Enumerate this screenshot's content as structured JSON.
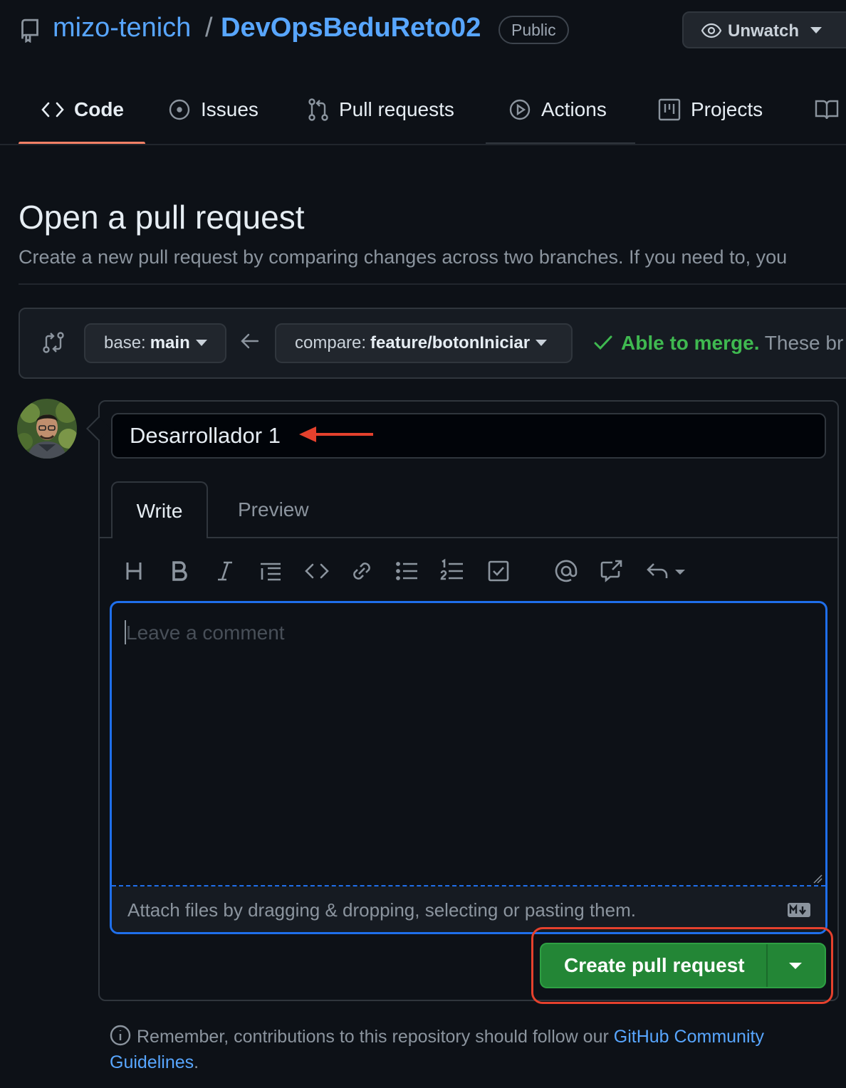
{
  "repo": {
    "owner": "mizo-tenich",
    "separator": "/",
    "name": "DevOpsBeduReto02",
    "visibility": "Public",
    "watch_label": "Unwatch"
  },
  "nav": {
    "tabs": [
      {
        "label": "Code",
        "icon": "code-icon",
        "selected": true
      },
      {
        "label": "Issues",
        "icon": "issue-icon"
      },
      {
        "label": "Pull requests",
        "icon": "pull-request-icon"
      },
      {
        "label": "Actions",
        "icon": "play-icon"
      },
      {
        "label": "Projects",
        "icon": "project-icon"
      },
      {
        "label": "",
        "icon": "book-icon"
      }
    ]
  },
  "page": {
    "title": "Open a pull request",
    "subtitle": "Create a new pull request by comparing changes across two branches. If you need to, you"
  },
  "compare": {
    "base_prefix": "base:",
    "base_branch": "main",
    "compare_prefix": "compare:",
    "compare_branch": "feature/botonIniciar",
    "merge_status": "Able to merge.",
    "merge_detail": "These br"
  },
  "form": {
    "title_value": "Desarrollador 1",
    "tab_write": "Write",
    "tab_preview": "Preview",
    "toolbar": [
      "heading-icon",
      "bold-icon",
      "italic-icon",
      "quote-icon",
      "code-icon",
      "link-icon",
      "bullet-list-icon",
      "numbered-list-icon",
      "task-list-icon",
      "mention-icon",
      "reference-icon",
      "reply-icon"
    ],
    "comment_placeholder": "Leave a comment",
    "attach_text": "Attach files by dragging & dropping, selecting or pasting them.",
    "submit_label": "Create pull request"
  },
  "footer": {
    "note_text": "Remember, contributions to this repository should follow our",
    "link_text_1": "GitHub Community",
    "link_text_2": "Guidelines",
    "tail": "."
  },
  "colors": {
    "accent_link": "#58a6ff",
    "success": "#3fb950",
    "primary_button": "#238636",
    "annotation_red": "#e5412d",
    "selected_tab_underline": "#f78166"
  }
}
